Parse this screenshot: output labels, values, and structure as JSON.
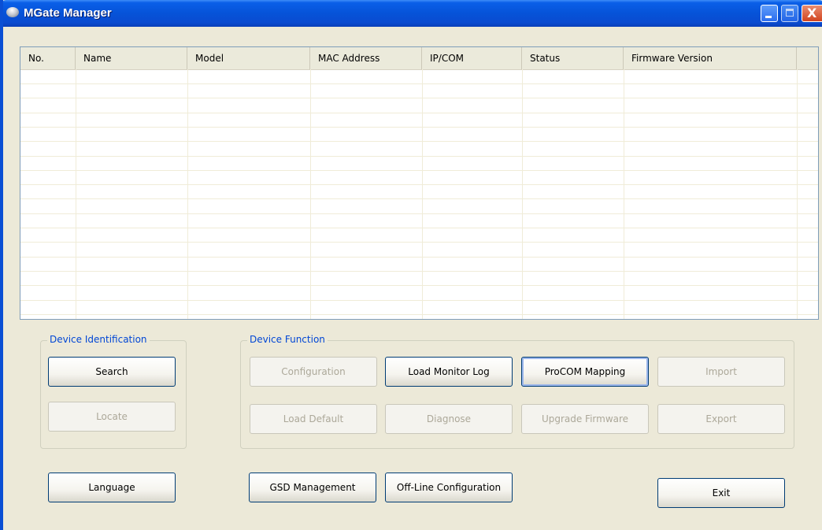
{
  "window": {
    "title": "MGate Manager",
    "icon": "mgate-app-icon"
  },
  "title_buttons": {
    "minimize": "minimize",
    "maximize": "maximize",
    "close": "X"
  },
  "table": {
    "columns": [
      "No.",
      "Name",
      "Model",
      "MAC Address",
      "IP/COM",
      "Status",
      "Firmware Version"
    ],
    "rows": []
  },
  "device_identification": {
    "legend": "Device Identification",
    "search": "Search",
    "locate": "Locate"
  },
  "device_function": {
    "legend": "Device Function",
    "configuration": "Configuration",
    "load_monitor_log": "Load Monitor Log",
    "procom_mapping": "ProCOM Mapping",
    "import": "Import",
    "load_default": "Load Default",
    "diagnose": "Diagnose",
    "upgrade_firmware": "Upgrade Firmware",
    "export": "Export"
  },
  "bottom": {
    "language": "Language",
    "gsd_management": "GSD Management",
    "offline_configuration": "Off-Line Configuration",
    "exit": "Exit"
  },
  "colors": {
    "title_bar": "#0a5fe8",
    "frame": "#ece9d8",
    "group_legend": "#0046d5",
    "disabled_text": "#aca899"
  }
}
